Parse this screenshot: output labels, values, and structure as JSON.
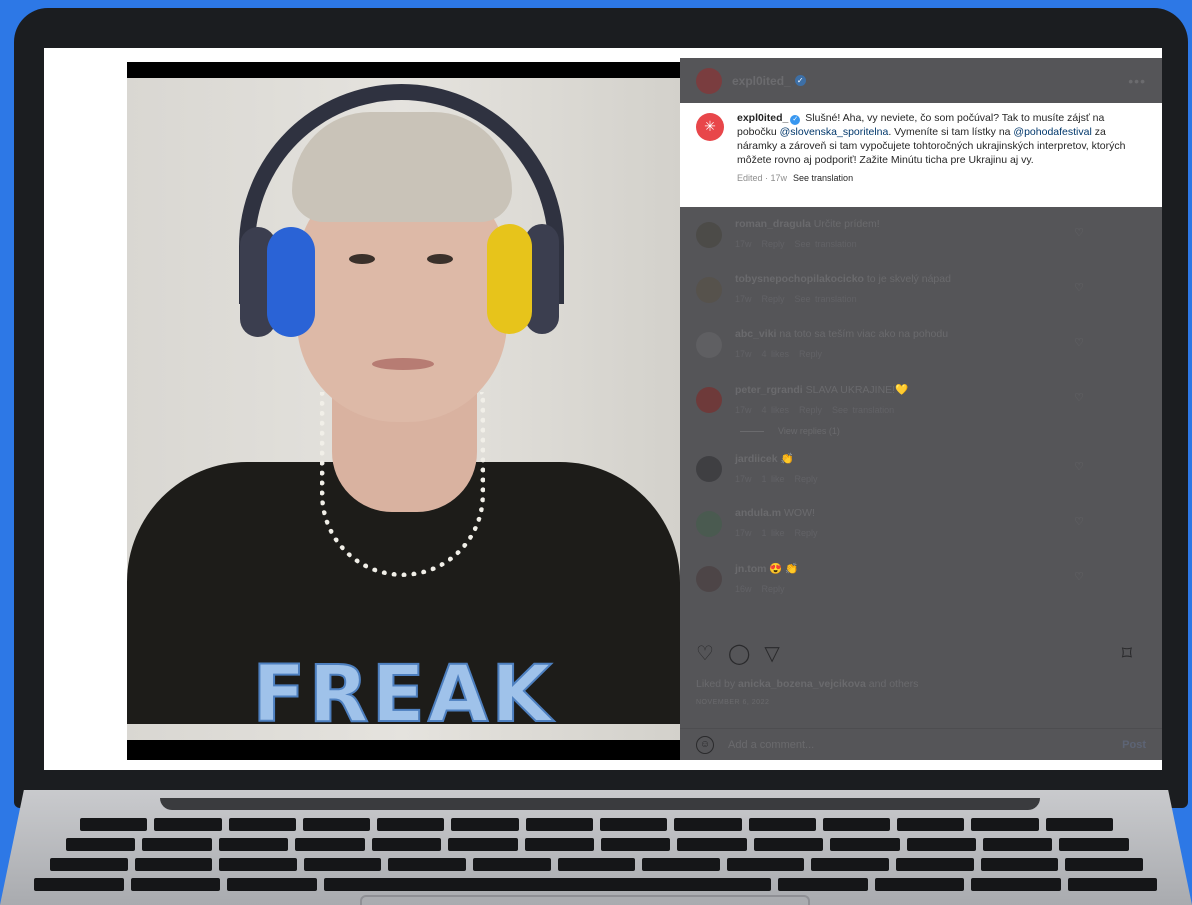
{
  "post": {
    "photo_shirt_text": "FREAK",
    "username": "expl0ited_",
    "verified_mark": "✓",
    "more_icon": "•••",
    "caption": {
      "username": "expl0ited_",
      "text_1": "Slušné! Aha, vy neviete, čo som počúval? Tak to musíte zájsť na pobočku ",
      "mention_1": "@slovenska_sporitelna",
      "text_2": ". Vymeníte si tam lístky na ",
      "mention_2": "@pohodafestival",
      "text_3": " za náramky a zároveň si tam vypočujete tohtoročných ukrajinských interpretov, ktorých môžete rovno aj podporiť! Zažite Minútu ticha pre Ukrajinu aj vy.",
      "meta": "Edited · 17w",
      "see_translation": "See translation"
    },
    "comments": [
      {
        "user": "roman_dragula",
        "text": "Určite prídem!",
        "meta": [
          "17w",
          "Reply",
          "See translation"
        ],
        "avatar_color": "#4c4b48"
      },
      {
        "user": "tobysnepochopilakocicko",
        "text": "to je skvelý nápad",
        "meta": [
          "17w",
          "Reply",
          "See translation"
        ],
        "avatar_color": "#56524c"
      },
      {
        "user": "abc_viki",
        "text": "na toto sa teším viac ako na pohodu",
        "meta": [
          "17w",
          "4 likes",
          "Reply"
        ],
        "avatar_color": "#5f5f62"
      },
      {
        "user": "peter_rgrandi",
        "text": "SLAVA UKRAJINE!💛",
        "meta": [
          "17w",
          "4 likes",
          "Reply",
          "See translation"
        ],
        "avatar_color": "#6e3a3a"
      },
      {
        "user": "jardiicek",
        "text": "👏",
        "meta": [
          "17w",
          "1 like",
          "Reply"
        ],
        "avatar_color": "#3f3f42"
      },
      {
        "user": "andula.m",
        "text": "WOW!",
        "meta": [
          "17w",
          "1 like",
          "Reply"
        ],
        "avatar_color": "#4a5a50"
      },
      {
        "user": "jn.tom",
        "text": "😍 👏",
        "meta": [
          "16w",
          "Reply"
        ],
        "avatar_color": "#4d4547"
      }
    ],
    "view_replies": "View replies (1)",
    "heart_icon": "♡",
    "actions": {
      "like": "♡",
      "comment": "◯",
      "share": "▽",
      "save": "⌑"
    },
    "liked_by_prefix": "Liked by ",
    "liked_by_user": "anicka_bozena_vejcikova",
    "liked_by_suffix": " and others",
    "date": "NOVEMBER 6, 2022",
    "add_comment": {
      "emoji": "☺",
      "placeholder": "Add a comment...",
      "post_label": "Post"
    }
  },
  "colors": {
    "background": "#2d78e6",
    "overlay": "#555558",
    "mention": "#00376b"
  }
}
